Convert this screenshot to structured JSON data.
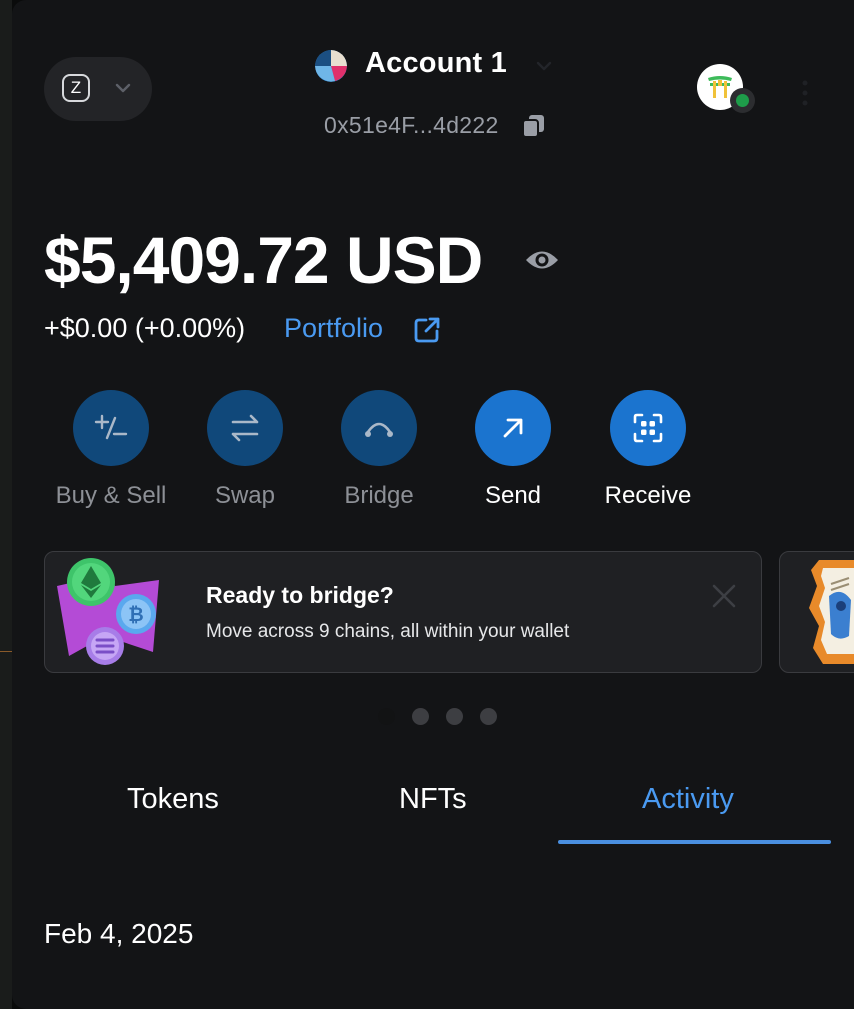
{
  "header": {
    "network_initial": "Z",
    "account_name": "Account 1",
    "account_address": "0x51e4F...4d222",
    "icons": [
      "chevron-down-icon",
      "copy-icon",
      "more-vertical-icon"
    ]
  },
  "balance": {
    "total": "$5,409.72 USD",
    "change": "+$0.00 (+0.00%)",
    "portfolio_label": "Portfolio"
  },
  "actions": [
    {
      "label": "Buy & Sell",
      "icon": "plus-minus-icon",
      "enabled": false
    },
    {
      "label": "Swap",
      "icon": "swap-arrows-icon",
      "enabled": false
    },
    {
      "label": "Bridge",
      "icon": "bridge-icon",
      "enabled": false
    },
    {
      "label": "Send",
      "icon": "arrow-up-right-icon",
      "enabled": true
    },
    {
      "label": "Receive",
      "icon": "qr-scan-icon",
      "enabled": true
    }
  ],
  "carousel": {
    "title": "Ready to bridge?",
    "text": "Move across 9 chains, all within your wallet",
    "slide_count": 4,
    "active_index": 0
  },
  "tabs": {
    "items": [
      "Tokens",
      "NFTs",
      "Activity"
    ],
    "active": "Activity"
  },
  "activity": {
    "date": "Feb 4, 2025"
  },
  "colors": {
    "accent": "#4a9af1",
    "button_active": "#1b74cf",
    "button_disabled": "#10487a",
    "background": "#131416",
    "connected": "#1e9d4a"
  }
}
